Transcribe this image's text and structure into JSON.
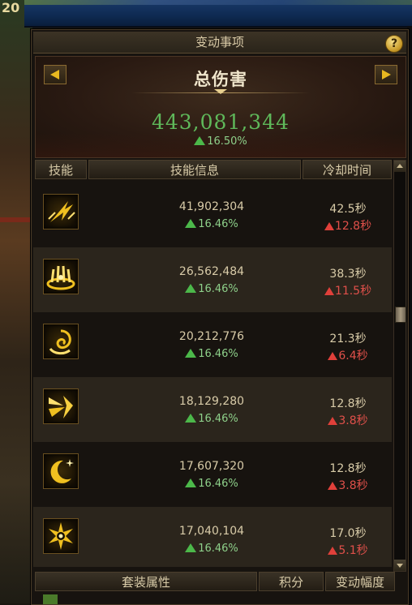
{
  "background": {
    "corner_number": "20"
  },
  "panel": {
    "title": "变动事项",
    "help_label": "?",
    "summary": {
      "title": "总伤害",
      "total_damage": "443,081,344",
      "change": "16.50%"
    },
    "headers": {
      "skill": "技能",
      "info": "技能信息",
      "cooldown": "冷却时间"
    },
    "skills": [
      {
        "icon": "slash-skill-icon",
        "damage": "41,902,304",
        "damage_change": "16.46%",
        "cooldown": "42.5秒",
        "cooldown_change": "12.8秒"
      },
      {
        "icon": "crown-burst-skill-icon",
        "damage": "26,562,484",
        "damage_change": "16.46%",
        "cooldown": "38.3秒",
        "cooldown_change": "11.5秒"
      },
      {
        "icon": "vortex-skill-icon",
        "damage": "20,212,776",
        "damage_change": "16.46%",
        "cooldown": "21.3秒",
        "cooldown_change": "6.4秒"
      },
      {
        "icon": "dash-strike-skill-icon",
        "damage": "18,129,280",
        "damage_change": "16.46%",
        "cooldown": "12.8秒",
        "cooldown_change": "3.8秒"
      },
      {
        "icon": "crescent-moon-skill-icon",
        "damage": "17,607,320",
        "damage_change": "16.46%",
        "cooldown": "12.8秒",
        "cooldown_change": "3.8秒"
      },
      {
        "icon": "radiant-cross-skill-icon",
        "damage": "17,040,104",
        "damage_change": "16.46%",
        "cooldown": "17.0秒",
        "cooldown_change": "5.1秒"
      }
    ],
    "footer_headers": {
      "set_attributes": "套装属性",
      "points": "积分",
      "change_range": "变动幅度"
    }
  },
  "colors": {
    "increase_green": "#4cb84a",
    "increase_red": "#e0403a",
    "total_damage_green": "#5fb85a",
    "gold_accent": "#e8b820"
  }
}
